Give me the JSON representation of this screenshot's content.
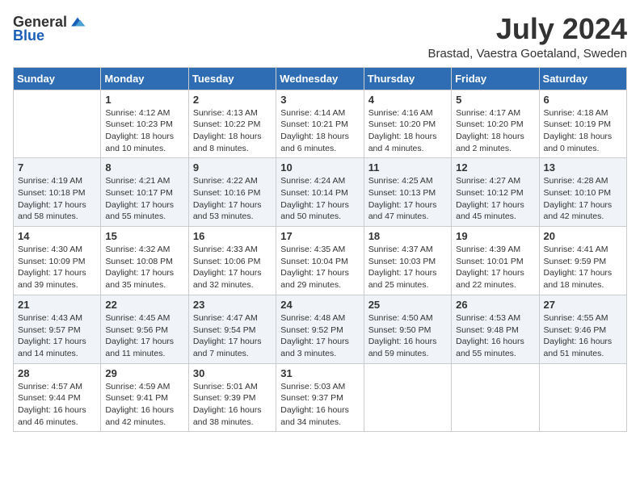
{
  "header": {
    "logo_general": "General",
    "logo_blue": "Blue",
    "month_title": "July 2024",
    "location": "Brastad, Vaestra Goetaland, Sweden"
  },
  "days_of_week": [
    "Sunday",
    "Monday",
    "Tuesday",
    "Wednesday",
    "Thursday",
    "Friday",
    "Saturday"
  ],
  "weeks": [
    {
      "shade": "white",
      "days": [
        {
          "num": "",
          "info": ""
        },
        {
          "num": "1",
          "info": "Sunrise: 4:12 AM\nSunset: 10:23 PM\nDaylight: 18 hours\nand 10 minutes."
        },
        {
          "num": "2",
          "info": "Sunrise: 4:13 AM\nSunset: 10:22 PM\nDaylight: 18 hours\nand 8 minutes."
        },
        {
          "num": "3",
          "info": "Sunrise: 4:14 AM\nSunset: 10:21 PM\nDaylight: 18 hours\nand 6 minutes."
        },
        {
          "num": "4",
          "info": "Sunrise: 4:16 AM\nSunset: 10:20 PM\nDaylight: 18 hours\nand 4 minutes."
        },
        {
          "num": "5",
          "info": "Sunrise: 4:17 AM\nSunset: 10:20 PM\nDaylight: 18 hours\nand 2 minutes."
        },
        {
          "num": "6",
          "info": "Sunrise: 4:18 AM\nSunset: 10:19 PM\nDaylight: 18 hours\nand 0 minutes."
        }
      ]
    },
    {
      "shade": "shaded",
      "days": [
        {
          "num": "7",
          "info": "Sunrise: 4:19 AM\nSunset: 10:18 PM\nDaylight: 17 hours\nand 58 minutes."
        },
        {
          "num": "8",
          "info": "Sunrise: 4:21 AM\nSunset: 10:17 PM\nDaylight: 17 hours\nand 55 minutes."
        },
        {
          "num": "9",
          "info": "Sunrise: 4:22 AM\nSunset: 10:16 PM\nDaylight: 17 hours\nand 53 minutes."
        },
        {
          "num": "10",
          "info": "Sunrise: 4:24 AM\nSunset: 10:14 PM\nDaylight: 17 hours\nand 50 minutes."
        },
        {
          "num": "11",
          "info": "Sunrise: 4:25 AM\nSunset: 10:13 PM\nDaylight: 17 hours\nand 47 minutes."
        },
        {
          "num": "12",
          "info": "Sunrise: 4:27 AM\nSunset: 10:12 PM\nDaylight: 17 hours\nand 45 minutes."
        },
        {
          "num": "13",
          "info": "Sunrise: 4:28 AM\nSunset: 10:10 PM\nDaylight: 17 hours\nand 42 minutes."
        }
      ]
    },
    {
      "shade": "white",
      "days": [
        {
          "num": "14",
          "info": "Sunrise: 4:30 AM\nSunset: 10:09 PM\nDaylight: 17 hours\nand 39 minutes."
        },
        {
          "num": "15",
          "info": "Sunrise: 4:32 AM\nSunset: 10:08 PM\nDaylight: 17 hours\nand 35 minutes."
        },
        {
          "num": "16",
          "info": "Sunrise: 4:33 AM\nSunset: 10:06 PM\nDaylight: 17 hours\nand 32 minutes."
        },
        {
          "num": "17",
          "info": "Sunrise: 4:35 AM\nSunset: 10:04 PM\nDaylight: 17 hours\nand 29 minutes."
        },
        {
          "num": "18",
          "info": "Sunrise: 4:37 AM\nSunset: 10:03 PM\nDaylight: 17 hours\nand 25 minutes."
        },
        {
          "num": "19",
          "info": "Sunrise: 4:39 AM\nSunset: 10:01 PM\nDaylight: 17 hours\nand 22 minutes."
        },
        {
          "num": "20",
          "info": "Sunrise: 4:41 AM\nSunset: 9:59 PM\nDaylight: 17 hours\nand 18 minutes."
        }
      ]
    },
    {
      "shade": "shaded",
      "days": [
        {
          "num": "21",
          "info": "Sunrise: 4:43 AM\nSunset: 9:57 PM\nDaylight: 17 hours\nand 14 minutes."
        },
        {
          "num": "22",
          "info": "Sunrise: 4:45 AM\nSunset: 9:56 PM\nDaylight: 17 hours\nand 11 minutes."
        },
        {
          "num": "23",
          "info": "Sunrise: 4:47 AM\nSunset: 9:54 PM\nDaylight: 17 hours\nand 7 minutes."
        },
        {
          "num": "24",
          "info": "Sunrise: 4:48 AM\nSunset: 9:52 PM\nDaylight: 17 hours\nand 3 minutes."
        },
        {
          "num": "25",
          "info": "Sunrise: 4:50 AM\nSunset: 9:50 PM\nDaylight: 16 hours\nand 59 minutes."
        },
        {
          "num": "26",
          "info": "Sunrise: 4:53 AM\nSunset: 9:48 PM\nDaylight: 16 hours\nand 55 minutes."
        },
        {
          "num": "27",
          "info": "Sunrise: 4:55 AM\nSunset: 9:46 PM\nDaylight: 16 hours\nand 51 minutes."
        }
      ]
    },
    {
      "shade": "white",
      "days": [
        {
          "num": "28",
          "info": "Sunrise: 4:57 AM\nSunset: 9:44 PM\nDaylight: 16 hours\nand 46 minutes."
        },
        {
          "num": "29",
          "info": "Sunrise: 4:59 AM\nSunset: 9:41 PM\nDaylight: 16 hours\nand 42 minutes."
        },
        {
          "num": "30",
          "info": "Sunrise: 5:01 AM\nSunset: 9:39 PM\nDaylight: 16 hours\nand 38 minutes."
        },
        {
          "num": "31",
          "info": "Sunrise: 5:03 AM\nSunset: 9:37 PM\nDaylight: 16 hours\nand 34 minutes."
        },
        {
          "num": "",
          "info": ""
        },
        {
          "num": "",
          "info": ""
        },
        {
          "num": "",
          "info": ""
        }
      ]
    }
  ]
}
